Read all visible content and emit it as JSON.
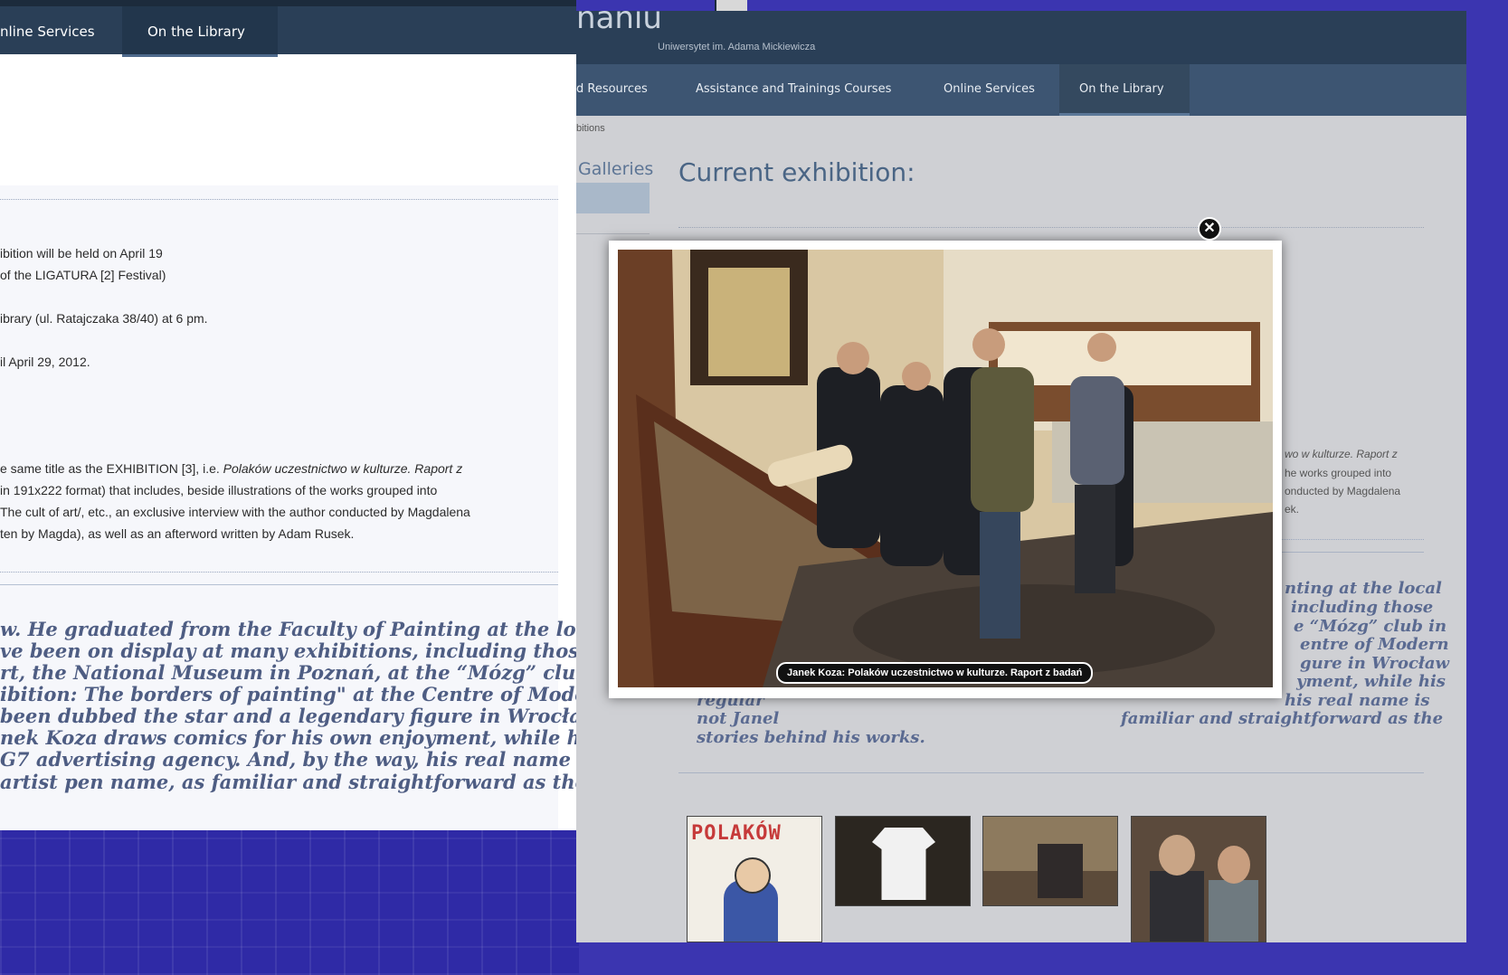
{
  "left_window": {
    "nav": [
      "nline Services",
      "On the Library"
    ],
    "event_lines": [
      "ibition will be held on April 19",
      "of the LIGATURA [2] Festival)",
      "ibrary (ul. Ratajczaka 38/40) at 6 pm.",
      "il April 29, 2012."
    ],
    "book_lines_plain": [
      "e same title as the EXHIBITION [3], i.e. ",
      "in 191x222 format) that includes, beside illustrations of the works grouped into",
      "The cult of art/, etc., an exclusive interview with the author conducted by Magdalena",
      "ten by Magda), as well as an afterword written by Adam Rusek."
    ],
    "book_line_italic": "Polaków uczestnictwo w kulturze. Raport z",
    "bio_lines": [
      "w. He graduated from the Faculty of Painting at the local",
      "ve been on display at many exhibitions, including those",
      "rt, the National Museum in Poznań, at the “Mózg” club in",
      "ibition: The borders of painting\" at the Centre of Modern",
      " been dubbed the star and a legendary figure in Wrocław",
      "nek Koza draws comics for his own enjoyment, while his",
      "G7 advertising agency. And, by the way, his real name is",
      " artist pen name, as familiar and straightforward as the"
    ]
  },
  "right_window": {
    "site_title_fragment": "naniu",
    "subtitle": "Uniwersytet im. Adama Mickiewicza",
    "nav": [
      "d Resources",
      "Assistance and Trainings Courses",
      "Online Services",
      "On the Library"
    ],
    "breadcrumb": "bitions",
    "sidebar_heading": "Galleries",
    "heading": "Current exhibition:",
    "side_text_lines": [
      "wo w kulturze. Raport z",
      "he works grouped into",
      "onducted by Magdalena",
      "ek."
    ],
    "bio_fragments_right": [
      "nting at the local",
      "including those",
      "e “Mózg” club in",
      "entre of Modern",
      "gure in Wrocław",
      "yment, while his",
      "his real name is",
      "familiar and straightforward as the"
    ],
    "bio_left_fragments": [
      "regular",
      "not Janel",
      "stories behind his works."
    ],
    "lightbox": {
      "caption": "Janek Koza: Polaków uczestnictwo w kulturze. Raport z badań",
      "close_symbol": "✕"
    },
    "thumbnail_poster_text": "POLAKÓW"
  }
}
